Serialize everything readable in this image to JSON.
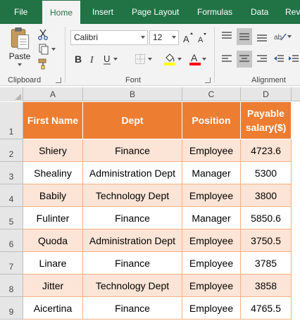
{
  "ribbon": {
    "tabs": [
      "File",
      "Home",
      "Insert",
      "Page Layout",
      "Formulas",
      "Data",
      "Rev"
    ],
    "active_tab": "Home",
    "clipboard": {
      "paste_label": "Paste",
      "group_label": "Clipboard"
    },
    "font": {
      "family": "Calibri",
      "size": "12",
      "group_label": "Font"
    },
    "alignment": {
      "group_label": "Alignment"
    }
  },
  "sheet": {
    "columns": [
      "A",
      "B",
      "C",
      "D"
    ],
    "rows": [
      "1",
      "2",
      "3",
      "4",
      "5",
      "6",
      "7",
      "8",
      "9"
    ],
    "header": [
      "First Name",
      "Dept",
      "Position",
      "Payable salary($)"
    ],
    "data": [
      [
        "Shiery",
        "Finance",
        "Employee",
        "4723.6"
      ],
      [
        "Shealiny",
        "Administration Dept",
        "Manager",
        "5300"
      ],
      [
        "Babily",
        "Technology Dept",
        "Employee",
        "3800"
      ],
      [
        "Fulinter",
        "Finance",
        "Manager",
        "5850.6"
      ],
      [
        "Quoda",
        "Administration Dept",
        "Employee",
        "3750.5"
      ],
      [
        "Linare",
        "Finance",
        "Employee",
        "3785"
      ],
      [
        "Jitter",
        "Technology Dept",
        "Employee",
        "3858"
      ],
      [
        "Aicertina",
        "Finance",
        "Employee",
        "4765.5"
      ]
    ]
  },
  "colors": {
    "ribbon_green": "#217346",
    "header_orange": "#ed7d31",
    "band_peach": "#fce4d6",
    "highlight_yellow": "#ffff00",
    "font_red": "#ff0000"
  }
}
